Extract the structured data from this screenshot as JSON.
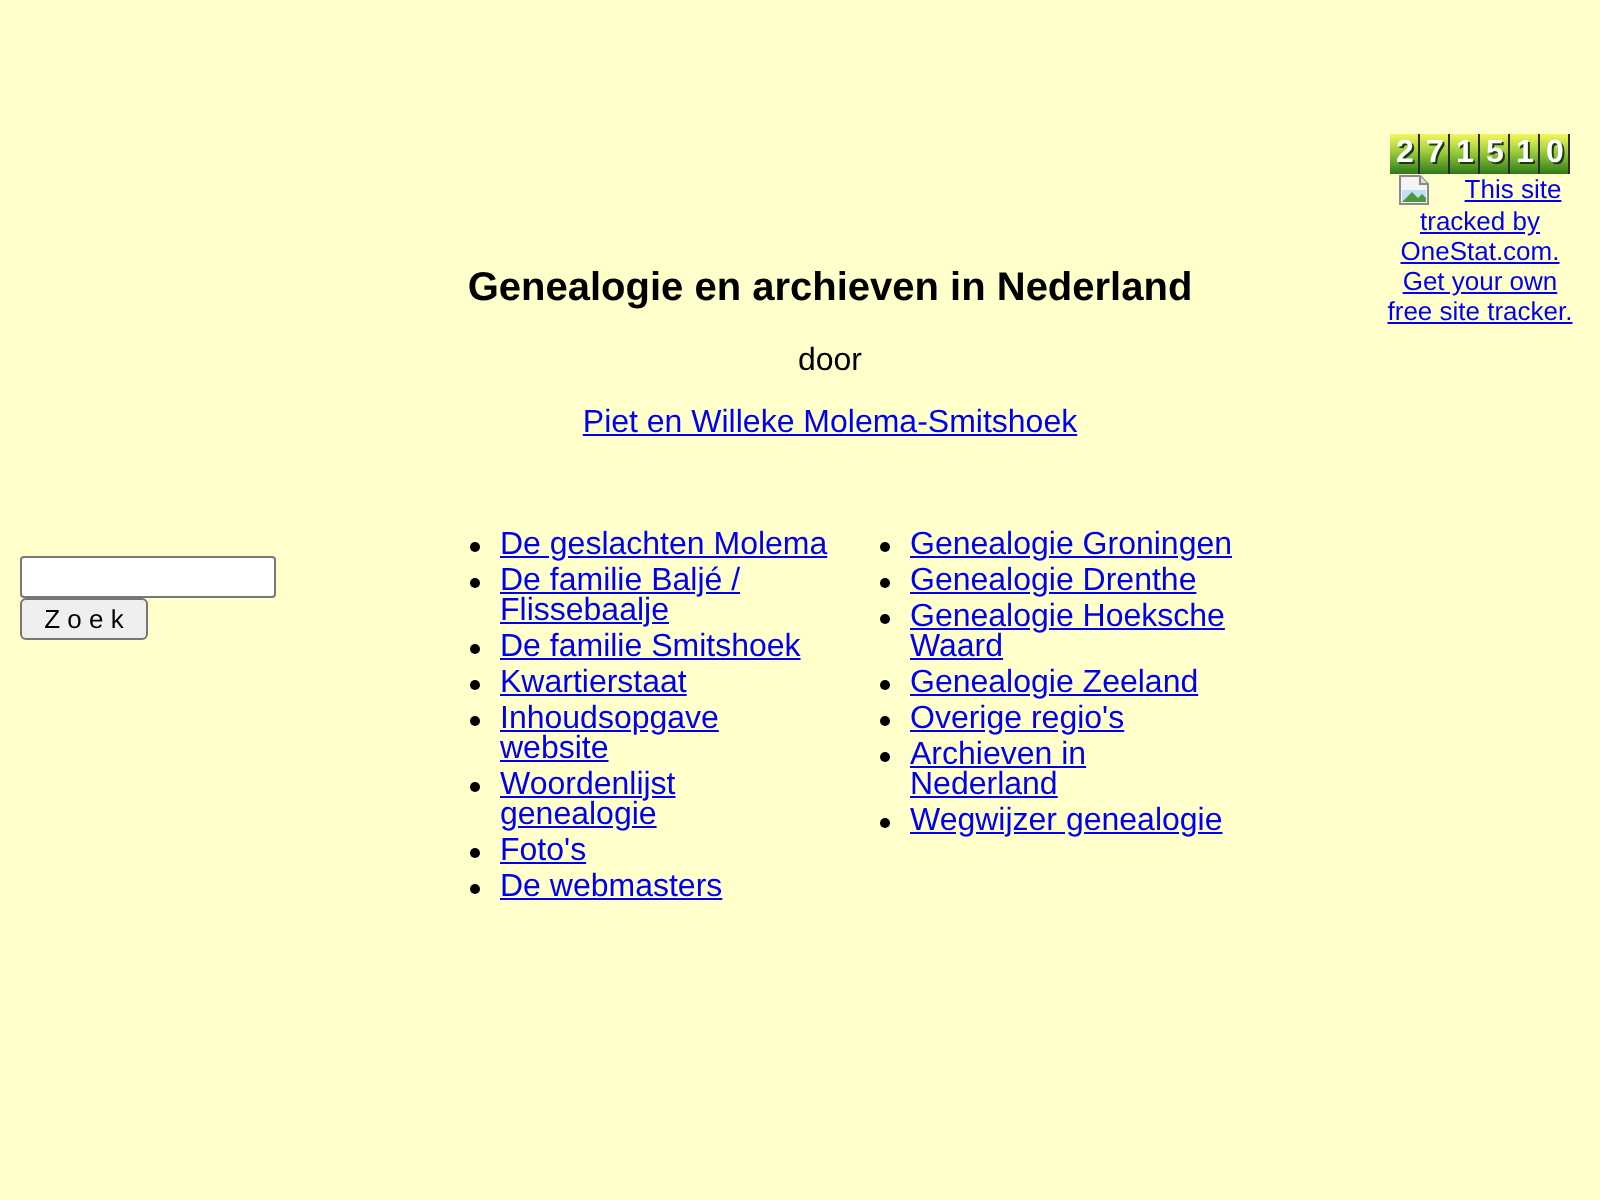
{
  "tracker": {
    "counter": "271510",
    "link": "This site tracked by OneStat.com. Get your own free site tracker."
  },
  "header": {
    "title": "Genealogie en archieven in Nederland",
    "byline": "door",
    "author_link": "Piet en Willeke Molema-Smitshoek"
  },
  "search": {
    "button": "Z o e k"
  },
  "menu_columns": [
    [
      "De geslachten Molema",
      "De familie Baljé / Flissebaalje",
      "De familie Smitshoek",
      "Kwartierstaat",
      "Inhoudsopgave website",
      "Woordenlijst genealogie",
      "Foto's",
      "De webmasters"
    ],
    [
      "Genealogie Groningen",
      "Genealogie Drenthe",
      "Genealogie Hoeksche Waard",
      "Genealogie Zeeland",
      "Overige regio's",
      "Archieven in Nederland",
      "Wegwijzer genealogie"
    ]
  ]
}
